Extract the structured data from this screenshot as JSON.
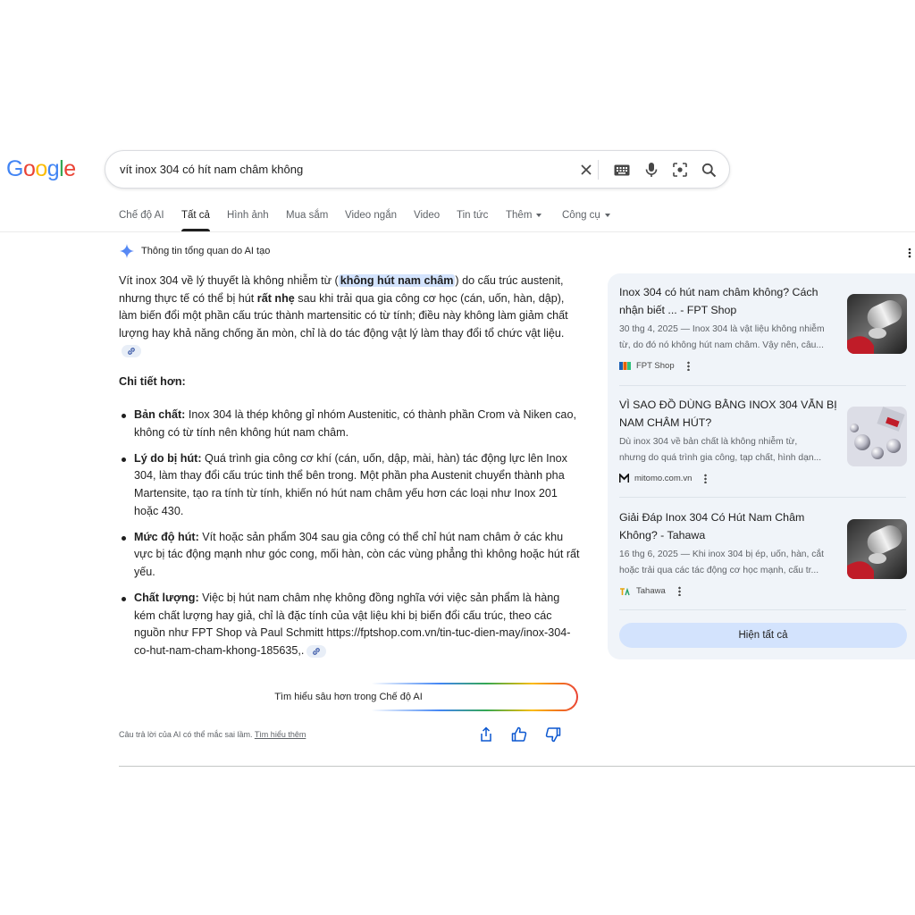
{
  "logo": {
    "letters": [
      "G",
      "o",
      "o",
      "g",
      "l",
      "e"
    ],
    "colors": [
      "#4285f4",
      "#ea4335",
      "#fbbc04",
      "#4285f4",
      "#34a853",
      "#ea4335"
    ]
  },
  "search": {
    "query": "vít inox 304 có hít nam châm không"
  },
  "tabs": {
    "ai_mode": "Chế độ AI",
    "all": "Tất cả",
    "images": "Hình ảnh",
    "shopping": "Mua sắm",
    "short_videos": "Video ngắn",
    "videos": "Video",
    "news": "Tin tức",
    "more": "Thêm",
    "tools": "Công cụ"
  },
  "ai_overview": {
    "header": "Thông tin tổng quan do AI tạo",
    "intro_part1": "Vít inox 304 về lý thuyết là không nhiễm từ (",
    "intro_highlight": "không hút nam châm",
    "intro_part2": ") do cấu trúc austenit, nhưng thực tế có thể bị hút ",
    "intro_bold": "rất nhẹ",
    "intro_part3": " sau khi trải qua gia công cơ học (cán, uốn, hàn, dập), làm biến đổi một phần cấu trúc thành martensitic có từ tính; điều này không làm giảm chất lượng hay khả năng chống ăn mòn, chỉ là do tác động vật lý làm thay đổi tổ chức vật liệu.",
    "details_heading": "Chi tiết hơn:",
    "bullets": [
      {
        "label": "Bản chất:",
        "text": " Inox 304 là thép không gỉ nhóm Austenitic, có thành phần Crom và Niken cao, không có từ tính nên không hút nam châm."
      },
      {
        "label": "Lý do bị hút:",
        "text": " Quá trình gia công cơ khí (cán, uốn, dập, mài, hàn) tác động lực lên Inox 304, làm thay đổi cấu trúc tinh thể bên trong. Một phần pha Austenit chuyển thành pha Martensite, tạo ra tính từ tính, khiến nó hút nam châm yếu hơn các loại như Inox 201 hoặc 430."
      },
      {
        "label": "Mức độ hút:",
        "text": " Vít hoặc sản phẩm 304 sau gia công có thể chỉ hút nam châm ở các khu vực bị tác động mạnh như góc cong, mối hàn, còn các vùng phẳng thì không hoặc hút rất yếu."
      },
      {
        "label": "Chất lượng:",
        "text": " Việc bị hút nam châm nhẹ không đồng nghĩa với việc sản phẩm là hàng kém chất lượng hay giả, chỉ là đặc tính của vật liệu khi bị biến đổi cấu trúc, theo các nguồn như FPT Shop và Paul Schmitt https://fptshop.com.vn/tin-tuc-dien-may/inox-304-co-hut-nam-cham-khong-185635,."
      }
    ],
    "deep_dive": "Tìm hiểu sâu hơn trong Chế độ AI",
    "disclaimer": "Câu trả lời của AI có thể mắc sai lầm. ",
    "learn_more": "Tìm hiểu thêm"
  },
  "sources": [
    {
      "title": "Inox 304 có hút nam châm không? Cách nhận biết ... - FPT Shop",
      "snippet1": "30 thg 4, 2025 — Inox 304 là vật liệu không nhiễm",
      "snippet2": "từ, do đó nó không hút nam châm. Vậy nên, câu...",
      "site": "FPT Shop"
    },
    {
      "title": "VÌ SAO ĐỒ DÙNG BẰNG INOX 304 VẪN BỊ NAM CHÂM HÚT?",
      "snippet1": "Dù inox 304 về bản chất là không nhiễm từ,",
      "snippet2": "nhưng do quá trình gia công, tạp chất, hình dạn...",
      "site": "mitomo.com.vn"
    },
    {
      "title": "Giải Đáp Inox 304 Có Hút Nam Châm Không? - Tahawa",
      "snippet1": "16 thg 6, 2025 — Khi inox 304 bị ép, uốn, hàn, cắt",
      "snippet2": "hoặc trải qua các tác động cơ học mạnh, cấu tr...",
      "site": "Tahawa"
    }
  ],
  "show_all": "Hiện tất cả"
}
